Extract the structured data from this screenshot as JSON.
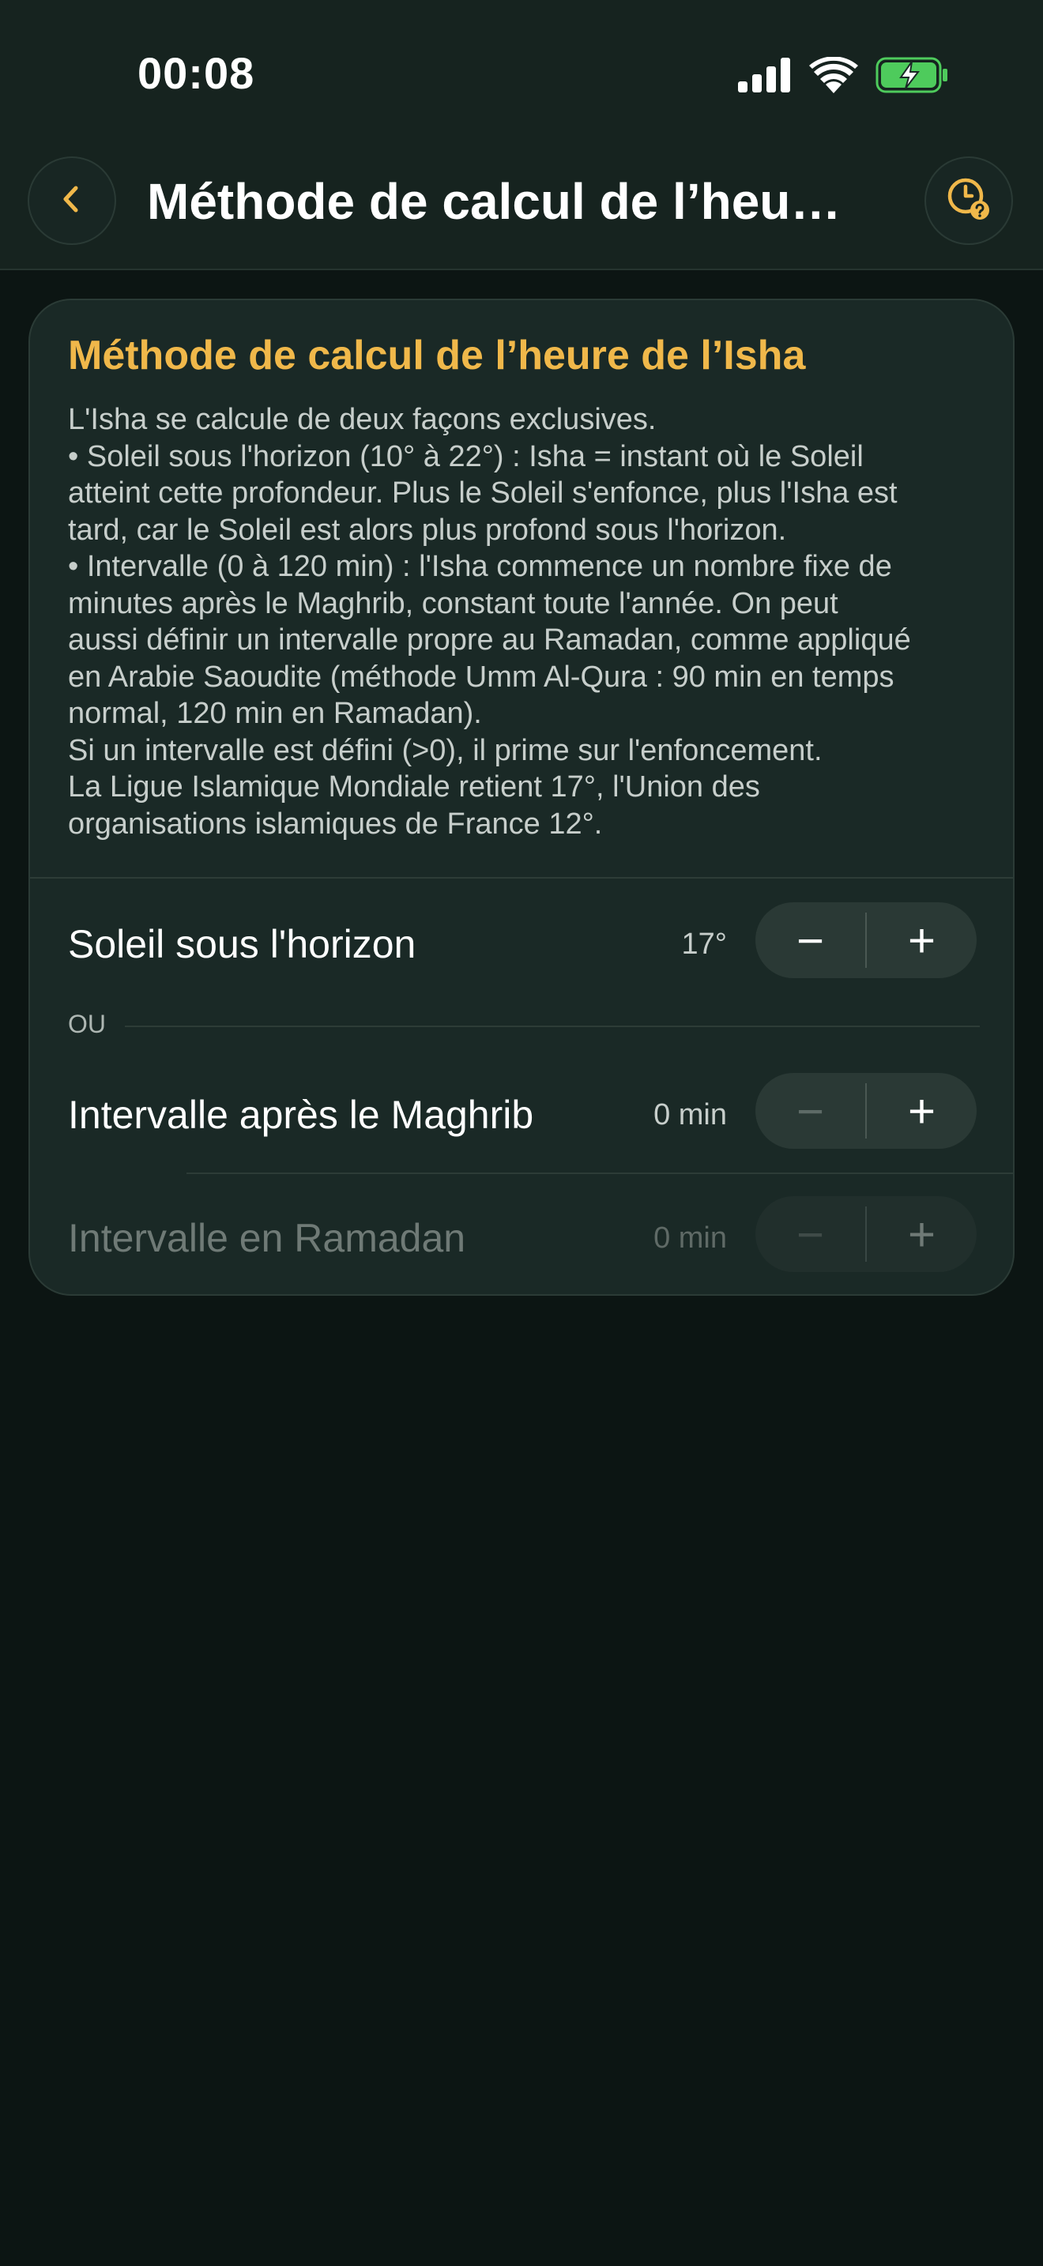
{
  "status_bar": {
    "time": "00:08"
  },
  "nav": {
    "title": "Méthode de calcul de l’heure de l’Isha",
    "back_icon": "chevron-left-icon",
    "help_icon": "clock-question-icon"
  },
  "colors": {
    "accent": "#f0b84a",
    "background": "#0c1513",
    "card": "#1a2926",
    "battery": "#4ecb5c"
  },
  "card": {
    "title": "Méthode de calcul de l’heure de l’Isha",
    "description_lines": [
      "L'Isha se calcule de deux façons exclusives.",
      "• Soleil sous l'horizon (10° à 22°) : Isha = instant où le Soleil",
      "atteint cette profondeur. Plus le Soleil s'enfonce, plus l'Isha est",
      "tard, car le Soleil est alors plus profond sous l'horizon.",
      "• Intervalle (0 à 120 min) : l'Isha commence un nombre fixe de",
      "minutes après le Maghrib, constant toute l'année. On peut",
      "aussi définir un intervalle propre au Ramadan, comme appliqué",
      "en Arabie Saoudite (méthode Umm Al-Qura : 90 min en temps",
      "normal, 120 min en Ramadan).",
      "Si un intervalle est défini (>0), il prime sur l'enfoncement.",
      "La Ligue Islamique Mondiale retient 17°, l'Union des",
      "organisations islamiques de France 12°."
    ],
    "separator_label": "OU",
    "rows": [
      {
        "label": "Soleil sous l'horizon",
        "value": "17°",
        "minus": "−",
        "plus": "+"
      },
      {
        "label": "Intervalle après le Maghrib",
        "value": "0 min",
        "minus": "−",
        "plus": "+"
      },
      {
        "label": "Intervalle en Ramadan",
        "value": "0 min",
        "minus": "−",
        "plus": "+"
      }
    ]
  }
}
